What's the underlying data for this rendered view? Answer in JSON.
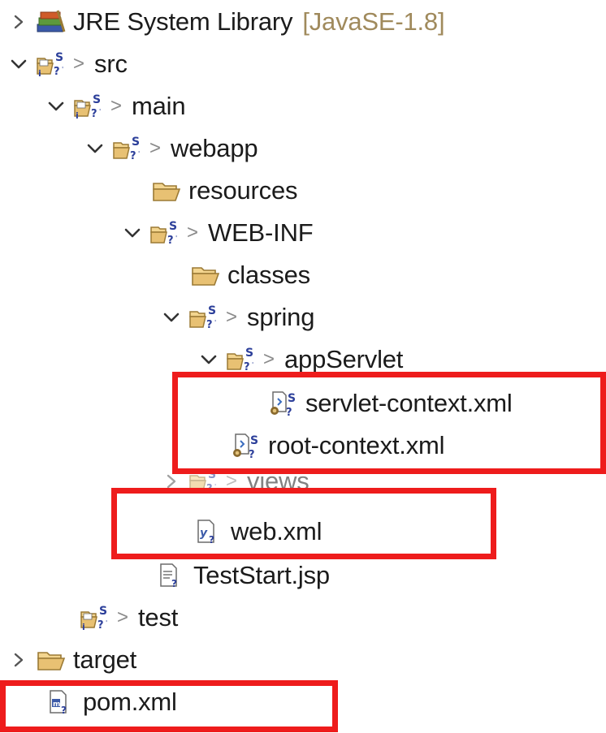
{
  "tree": {
    "jre_library": {
      "label": "JRE System Library",
      "decoration": "[JavaSE-1.8]",
      "icon": "library-icon"
    },
    "src": {
      "prefix": ">",
      "label": "src",
      "icon": "source-folder-icon"
    },
    "main": {
      "prefix": ">",
      "label": "main",
      "icon": "source-folder-icon"
    },
    "webapp": {
      "prefix": ">",
      "label": "webapp",
      "icon": "folder-icon"
    },
    "resources": {
      "label": "resources",
      "icon": "folder-icon"
    },
    "web_inf": {
      "prefix": ">",
      "label": "WEB-INF",
      "icon": "folder-icon"
    },
    "classes": {
      "label": "classes",
      "icon": "folder-icon"
    },
    "spring": {
      "prefix": ">",
      "label": "spring",
      "icon": "folder-icon"
    },
    "app_servlet": {
      "prefix": ">",
      "label": "appServlet",
      "icon": "folder-icon"
    },
    "servlet_context": {
      "label": "servlet-context.xml",
      "icon": "spring-xml-file-icon"
    },
    "root_context": {
      "label": "root-context.xml",
      "icon": "spring-xml-file-icon"
    },
    "views": {
      "prefix": ">",
      "label": "views",
      "icon": "folder-icon"
    },
    "web_xml": {
      "label": "web.xml",
      "icon": "xml-file-icon"
    },
    "test_start": {
      "label": "TestStart.jsp",
      "icon": "jsp-file-icon"
    },
    "test": {
      "prefix": ">",
      "label": "test",
      "icon": "source-folder-icon"
    },
    "target": {
      "label": "target",
      "icon": "folder-icon"
    },
    "pom": {
      "label": "pom.xml",
      "icon": "maven-pom-icon"
    }
  },
  "colors": {
    "highlight": "#ee1c1c",
    "folder": "#e8c173",
    "svn_badge": "#2c3f9a",
    "decoration": "#a08a5c"
  }
}
